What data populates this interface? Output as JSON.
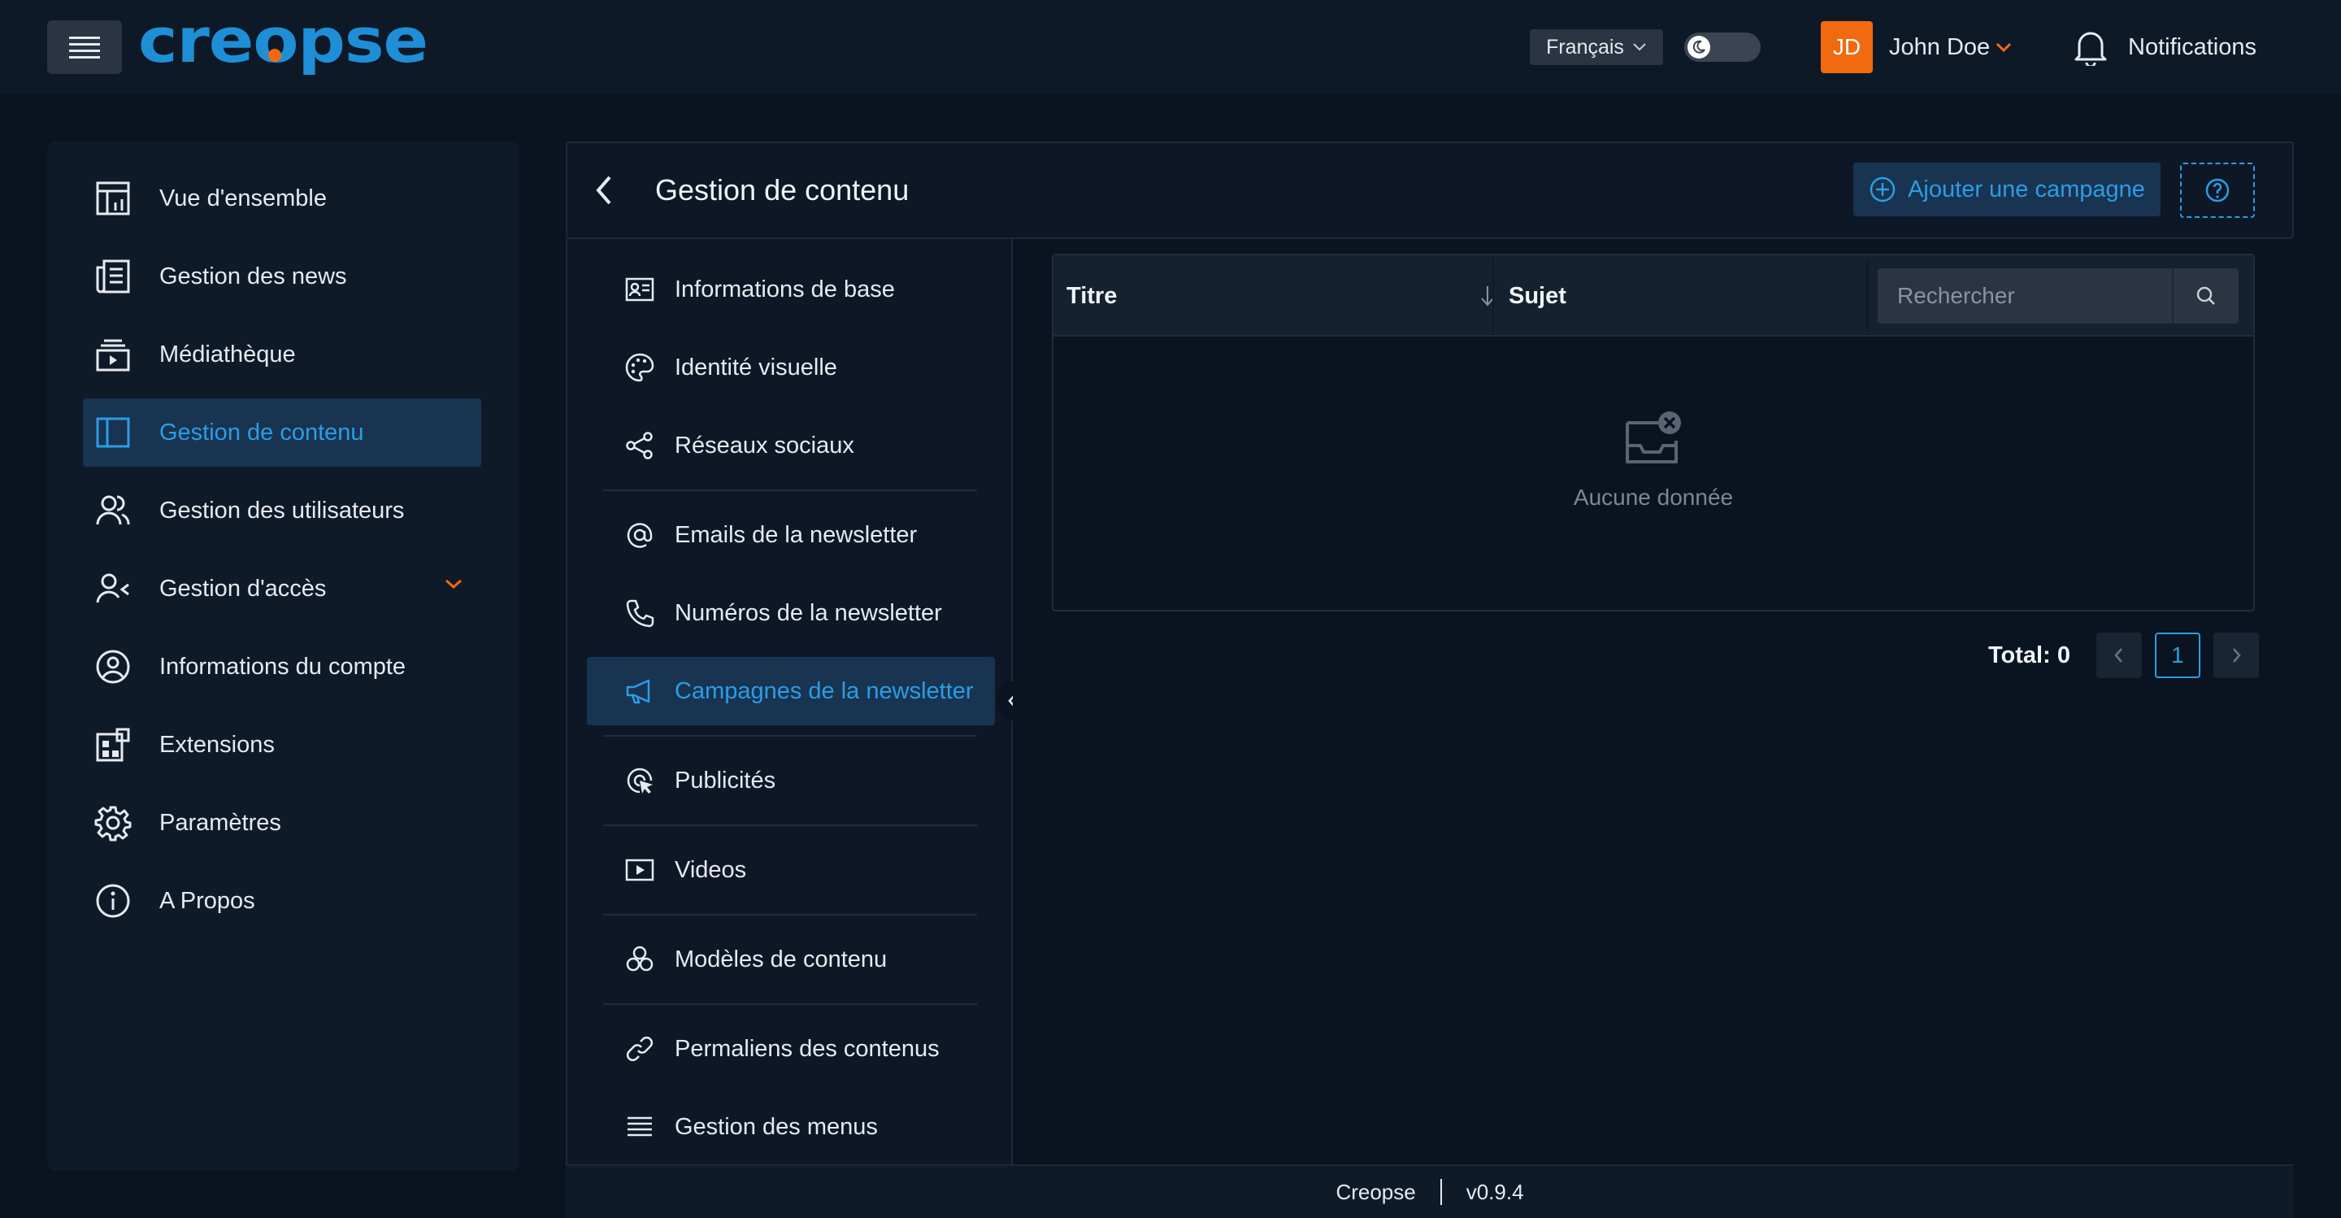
{
  "header": {
    "logo": "creopse",
    "language": "Français",
    "avatar_initials": "JD",
    "user_name": "John Doe",
    "notifications_label": "Notifications"
  },
  "sidebar": {
    "items": [
      {
        "label": "Vue d'ensemble",
        "icon": "dashboard-icon"
      },
      {
        "label": "Gestion des news",
        "icon": "newspaper-icon"
      },
      {
        "label": "Médiathèque",
        "icon": "media-library-icon"
      },
      {
        "label": "Gestion de contenu",
        "icon": "layout-panel-icon",
        "active": true
      },
      {
        "label": "Gestion des utilisateurs",
        "icon": "users-icon"
      },
      {
        "label": "Gestion d'accès",
        "icon": "user-access-icon",
        "expandable": true
      },
      {
        "label": "Informations du compte",
        "icon": "account-circle-icon"
      },
      {
        "label": "Extensions",
        "icon": "extensions-icon"
      },
      {
        "label": "Paramètres",
        "icon": "gear-icon"
      },
      {
        "label": "A Propos",
        "icon": "info-icon"
      }
    ]
  },
  "page": {
    "title": "Gestion de contenu",
    "add_button": "Ajouter une campagne"
  },
  "submenu": {
    "items": [
      {
        "label": "Informations de base",
        "icon": "id-card-icon"
      },
      {
        "label": "Identité visuelle",
        "icon": "palette-icon"
      },
      {
        "label": "Réseaux sociaux",
        "icon": "share-icon"
      },
      {
        "label": "Emails de la newsletter",
        "icon": "at-sign-icon"
      },
      {
        "label": "Numéros de la newsletter",
        "icon": "phone-icon"
      },
      {
        "label": "Campagnes de la newsletter",
        "icon": "megaphone-icon",
        "active": true
      },
      {
        "label": "Publicités",
        "icon": "ad-target-icon"
      },
      {
        "label": "Videos",
        "icon": "video-icon"
      },
      {
        "label": "Modèles de contenu",
        "icon": "blocks-icon"
      },
      {
        "label": "Permaliens des contenus",
        "icon": "link-icon"
      },
      {
        "label": "Gestion des menus",
        "icon": "menu-lines-icon"
      }
    ]
  },
  "table": {
    "columns": [
      "Titre",
      "Sujet"
    ],
    "search_placeholder": "Rechercher",
    "empty_text": "Aucune donnée",
    "rows": []
  },
  "pagination": {
    "total_label": "Total: 0",
    "current_page": "1"
  },
  "footer": {
    "app_name": "Creopse",
    "version": "v0.9.4"
  },
  "colors": {
    "background": "#0a1320",
    "panel": "#0f1a29",
    "accent": "#2b9de6",
    "active_bg": "#183451",
    "avatar": "#f26a0f",
    "chevron_accent": "#f26a0f"
  }
}
